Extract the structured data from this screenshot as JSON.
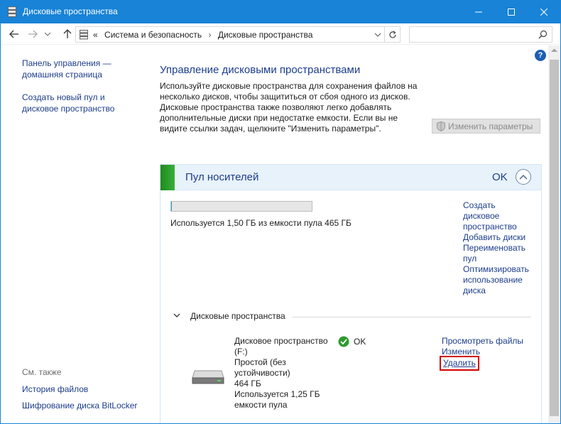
{
  "window": {
    "title": "Дисковые пространства",
    "accent_color": "#1883d7"
  },
  "navigation": {
    "breadcrumb_prefix": "«",
    "breadcrumbs": [
      "Система и безопасность",
      "Дисковые пространства"
    ],
    "search_placeholder": ""
  },
  "sidebar": {
    "items": [
      {
        "label_line1": "Панель управления —",
        "label_line2": "домашняя страница"
      },
      {
        "label_line1": "Создать новый пул и",
        "label_line2": "дисковое пространство"
      }
    ],
    "see_also_title": "См. также",
    "see_also": [
      "История файлов",
      "Шифрование диска BitLocker"
    ]
  },
  "main": {
    "title": "Управление дисковыми пространствами",
    "intro_lines": [
      "Используйте дисковые пространства для сохранения файлов на",
      "несколько дисков, чтобы защититься от сбоя одного из дисков.",
      "Дисковые пространства также позволяют легко добавлять",
      "дополнительные диски при недостатке емкости. Если вы не",
      "видите ссылки задач, щелкните \"Изменить параметры\"."
    ],
    "change_params_label": "Изменить параметры"
  },
  "pool": {
    "title": "Пул носителей",
    "status": "OK",
    "usage_fraction": 0.0032,
    "usage_text": "Используется 1,50 ГБ из емкости пула 465 ГБ",
    "links": [
      "Создать",
      "дисковое",
      "пространство",
      "Добавить диски",
      "Переименовать",
      "пул",
      "Оптимизировать",
      "использование",
      "диска"
    ],
    "spaces_section_label": "Дисковые пространства",
    "space": {
      "info_lines": [
        "Дисковое пространство",
        "(F:)",
        "Простой (без",
        "устойчивости)",
        "464 ГБ",
        "Используется 1,25 ГБ",
        "емкости пула"
      ],
      "status": "OK",
      "links": {
        "view": "Просмотреть файлы",
        "change": "Изменить",
        "delete": "Удалить"
      }
    }
  },
  "help_label": "?"
}
